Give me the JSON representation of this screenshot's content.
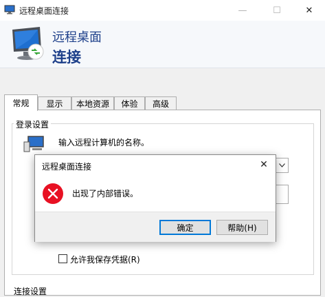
{
  "window": {
    "title": "远程桌面连接",
    "controls": {
      "minimize": "—",
      "maximize": "☐",
      "close": "✕"
    }
  },
  "header": {
    "line1": "远程桌面",
    "line2": "连接",
    "icon": "remote-desktop-monitor-icon"
  },
  "tabs": [
    {
      "label": "常规",
      "active": true
    },
    {
      "label": "显示",
      "active": false
    },
    {
      "label": "本地资源",
      "active": false
    },
    {
      "label": "体验",
      "active": false
    },
    {
      "label": "高级",
      "active": false
    }
  ],
  "general": {
    "login_group_label": "登录设置",
    "computer_prompt": "输入远程计算机的名称。",
    "save_credentials_label": "允许我保存凭据(R)",
    "save_credentials_checked": false,
    "connection_group_label": "连接设置"
  },
  "dialog": {
    "title": "远程桌面连接",
    "message": "出现了内部错误。",
    "ok_label": "确定",
    "help_label": "帮助(H)",
    "close_glyph": "✕",
    "icon": "error-icon",
    "icon_color": "#e81123"
  },
  "colors": {
    "header_text": "#1d3f8a",
    "accent": "#0078d7",
    "error": "#e81123"
  }
}
